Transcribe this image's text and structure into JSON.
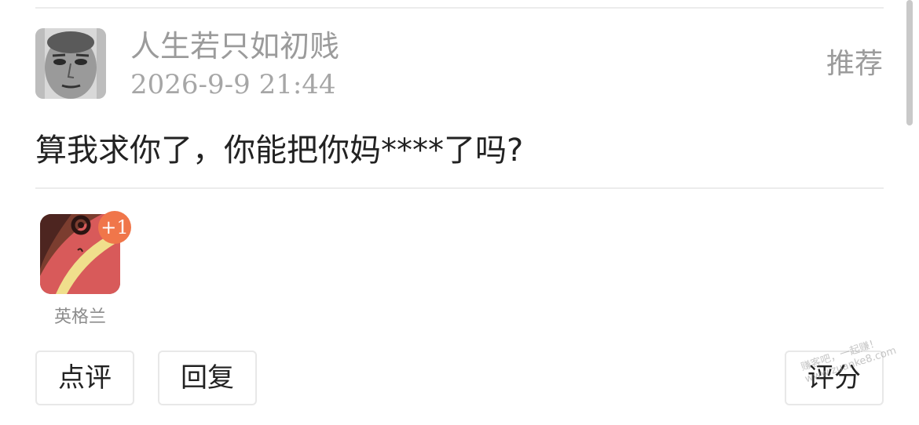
{
  "post": {
    "author": "人生若只如初贱",
    "timestamp": "2026-9-9 21:44",
    "recommend_label": "推荐",
    "content": "算我求你了，你能把你妈****了吗?"
  },
  "rating": {
    "score_badge": "+1",
    "rater_name": "英格兰"
  },
  "actions": {
    "comment_label": "点评",
    "reply_label": "回复",
    "rate_label": "评分"
  },
  "watermark": {
    "line1": "赚客吧，一起赚！",
    "line2": "www.zuanke8.com"
  }
}
